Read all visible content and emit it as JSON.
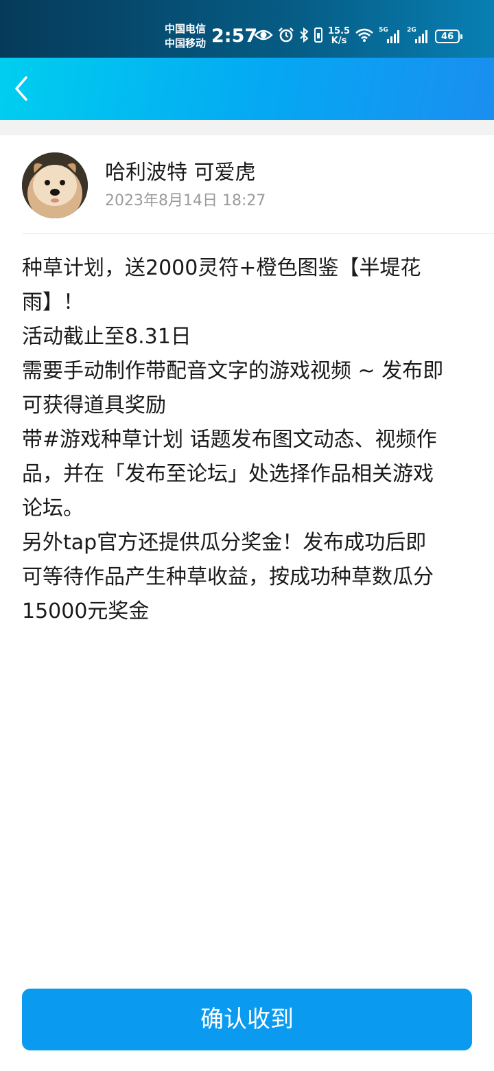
{
  "status_bar": {
    "carrier_1": "中国电信",
    "carrier_2": "中国移动",
    "time": "2:57",
    "net_speed_value": "15.5",
    "net_speed_unit": "K/s",
    "signal_1_tag": "5G",
    "signal_2_tag": "2G",
    "battery_level": "46",
    "icons": [
      "eye-icon",
      "alarm-icon",
      "bluetooth-icon",
      "vibrate-icon",
      "wifi-icon",
      "signal-icon",
      "signal-icon",
      "battery-icon"
    ]
  },
  "nav": {
    "back_icon": "chevron-left-icon"
  },
  "post": {
    "author_name": "哈利波特 可爱虎",
    "timestamp": "2023年8月14日 18:27",
    "avatar": "dog-avatar",
    "body_lines": [
      "种草计划，送2000灵符+橙色图鉴【半堤花",
      "雨】！",
      "活动截止至8.31日",
      "需要手动制作带配音文字的游戏视频 ~ 发布即",
      "可获得道具奖励",
      "带#游戏种草计划 话题发布图文动态、视频作",
      "品，并在「发布至论坛」处选择作品相关游戏",
      "论坛。",
      "另外tap官方还提供瓜分奖金！发布成功后即",
      "可等待作品产生种草收益，按成功种草数瓜分",
      "15000元奖金"
    ]
  },
  "footer": {
    "confirm_label": "确认收到"
  },
  "colors": {
    "header_gradient_start": "#00d0ef",
    "header_gradient_end": "#1a8ef0",
    "status_bar": "#065d86",
    "button": "#0a9af0",
    "timestamp": "#9a9a9a"
  }
}
